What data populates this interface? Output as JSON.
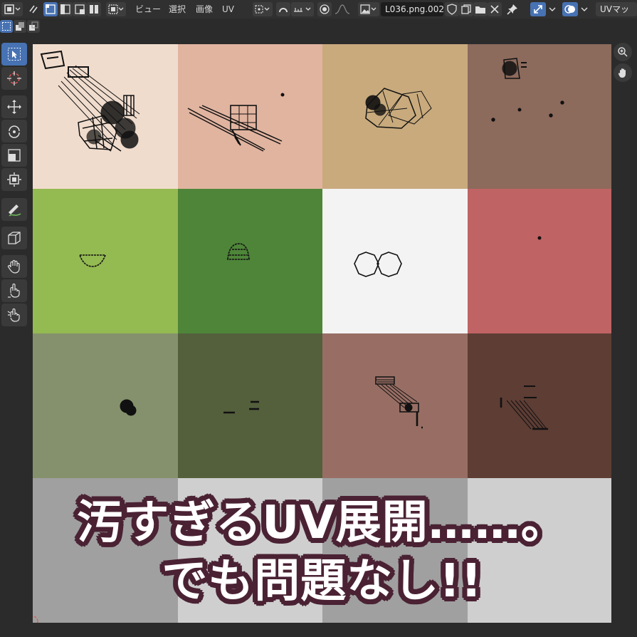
{
  "header": {
    "menu": [
      "ビュー",
      "選択",
      "画像",
      "UV"
    ],
    "image_name": "L036.png.002",
    "uv_map_label": "UVマップ"
  },
  "icons": {
    "editor_type": "uv-editor-icon",
    "sync": "sync-selection-icon",
    "pin": "pin-icon",
    "pivot": "pivot-icon",
    "snap": "snap-icon",
    "proportional": "proportional-icon",
    "zoom": "zoom-icon",
    "hand": "hand-icon"
  },
  "grid_colors": [
    "#f0dccd",
    "#e1b4a0",
    "#c8aa7d",
    "#8c6a5c",
    "#94ba52",
    "#4e8539",
    "#f3f3f3",
    "#c06364",
    "#84916c",
    "#545f3c",
    "#986e64",
    "#5d3d34",
    "#a0a0a0",
    "#cfcfcf",
    "#a0a0a0",
    "#cfcfcf"
  ],
  "caption": {
    "line1": "汚すぎるUV展開……。",
    "line2": "でも問題なし!!"
  },
  "colors": {
    "caption_outline": "#4a2233",
    "accent": "#4772b3"
  }
}
